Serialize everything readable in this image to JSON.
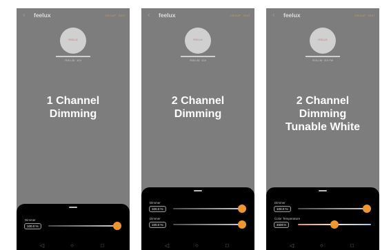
{
  "header": {
    "back_icon": "back-chevron-icon",
    "app_title": "feelux",
    "group_label": "GROUP",
    "edit_label": "EDIT"
  },
  "device": {
    "brand_label": "FEELUX",
    "ids": [
      "FDS-L36 · 1Ch",
      "FDS-L36 · 2Ch",
      "FDS-L36 · 2Ch TW"
    ]
  },
  "captions": [
    [
      "1 Channel",
      "Dimming"
    ],
    [
      "2 Channel",
      "Dimming"
    ],
    [
      "2 Channel",
      "Dimming",
      "Tunable White"
    ]
  ],
  "panels": {
    "one_ch": {
      "dimmer_label": "Dimmer",
      "dimmer_value": "100.0 %",
      "dimmer_level": 1.0
    },
    "two_ch": {
      "dimmer1_label": "Dimmer",
      "dimmer1_value": "100.0 %",
      "dimmer1_level": 1.0,
      "dimmer2_label": "Dimmer",
      "dimmer2_value": "100.0 %",
      "dimmer2_level": 1.0
    },
    "tw": {
      "dimmer_label": "Dimmer",
      "dimmer_value": "100.0 %",
      "dimmer_level": 1.0,
      "ct_label": "Color Temperature",
      "ct_value": "4600 K",
      "ct_level": 0.5
    }
  },
  "nav_icons": [
    "back-triangle-icon",
    "home-circle-icon",
    "recents-square-icon"
  ],
  "colors": {
    "accent": "#f0962b",
    "screen_bg": "#7d7d7d",
    "sheet_bg": "#000000"
  }
}
